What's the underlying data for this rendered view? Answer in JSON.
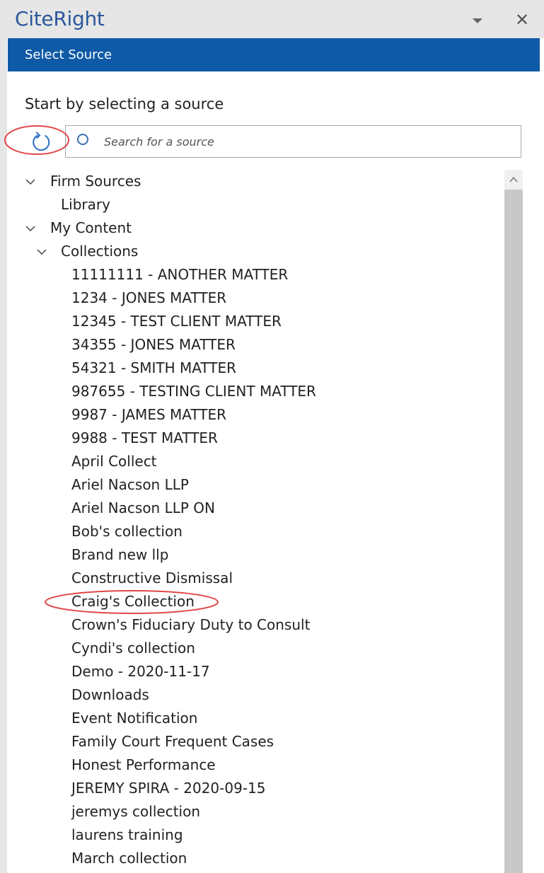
{
  "app": {
    "title": "CiteRight"
  },
  "header": {
    "section_title": "Select Source"
  },
  "main": {
    "prompt": "Start by selecting a source",
    "search": {
      "placeholder": "Search for a source",
      "value": ""
    }
  },
  "tree": {
    "firm_sources": {
      "label": "Firm Sources",
      "expanded": true,
      "children": [
        "Library"
      ]
    },
    "my_content": {
      "label": "My Content",
      "expanded": true,
      "collections": {
        "label": "Collections",
        "expanded": true,
        "items": [
          "11111111 - ANOTHER MATTER",
          "1234 - JONES MATTER",
          "12345 - TEST CLIENT MATTER",
          "34355 - JONES MATTER",
          "54321 - SMITH MATTER",
          "987655 - TESTING CLIENT MATTER",
          "9987 - JAMES MATTER",
          "9988 - TEST MATTER",
          "April Collect",
          "Ariel Nacson LLP",
          "Ariel Nacson LLP ON",
          "Bob's collection",
          "Brand new llp",
          "Constructive Dismissal",
          "Craig's Collection",
          "Crown's Fiduciary Duty to Consult",
          "Cyndi's collection",
          "Demo - 2020-11-17",
          "Downloads",
          "Event Notification",
          "Family Court Frequent Cases",
          "Honest Performance",
          "JEREMY SPIRA - 2020-09-15",
          "jeremys collection",
          "laurens training",
          "March collection"
        ]
      }
    }
  },
  "colors": {
    "accent": "#0f5aa6",
    "title_text": "#2b579a",
    "highlight": "#e04848"
  },
  "icons": {
    "refresh": "refresh-icon",
    "search": "search-icon",
    "close": "close-icon",
    "dropdown": "chevron-down-icon"
  }
}
